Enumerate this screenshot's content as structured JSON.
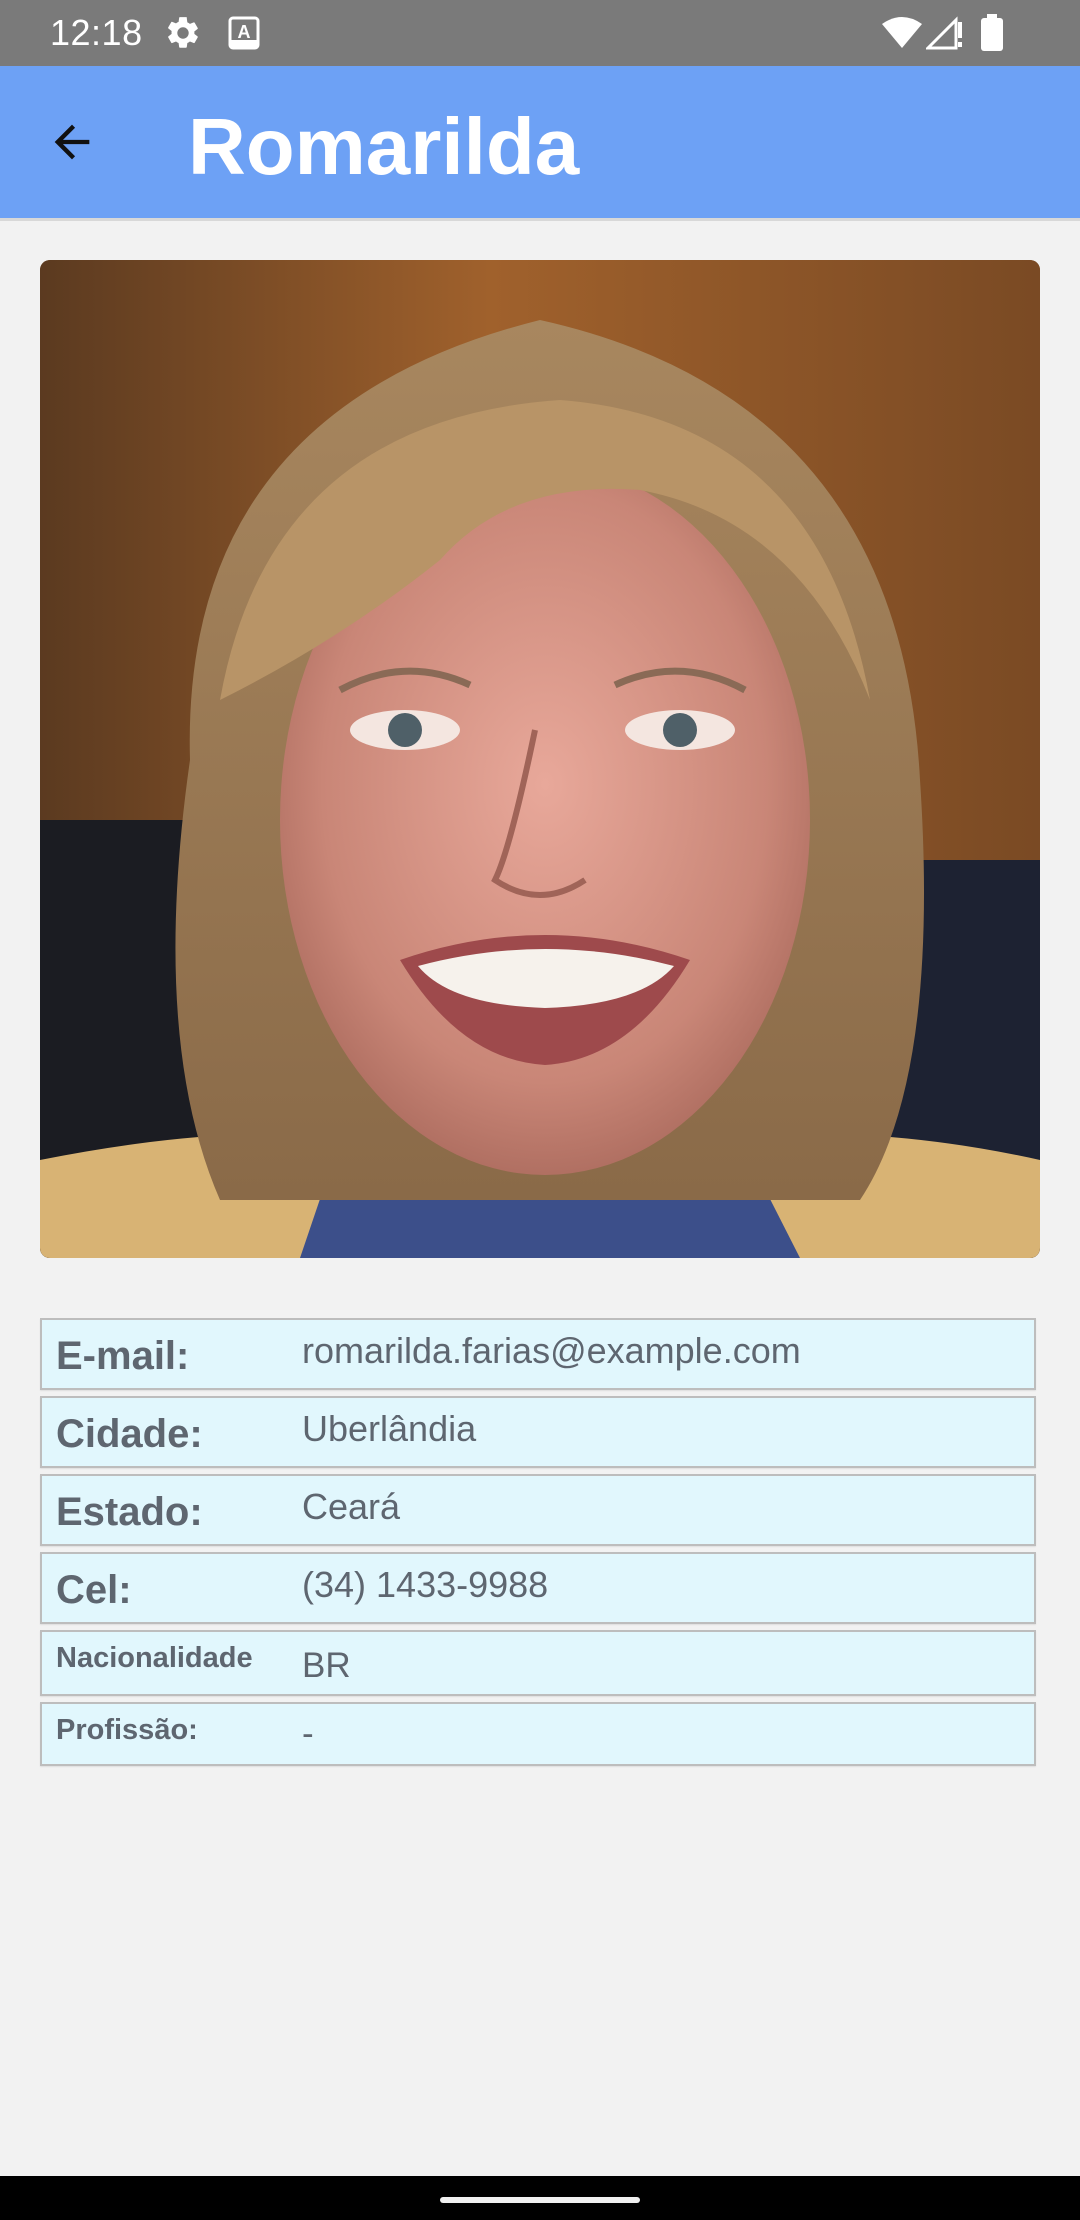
{
  "status_bar": {
    "time": "12:18",
    "icons": [
      "gear-icon",
      "font-a-icon",
      "wifi-icon",
      "signal-icon",
      "battery-icon"
    ]
  },
  "app_bar": {
    "title": "Romarilda",
    "back_icon": "arrow-back-icon",
    "color": "#6da1f5"
  },
  "profile_photo": {
    "subject": "smiling woman with shoulder-length blond hair"
  },
  "details": [
    {
      "label": "E-mail:",
      "value": "romarilda.farias@example.com"
    },
    {
      "label": "Cidade:",
      "value": "Uberlândia"
    },
    {
      "label": "Estado:",
      "value": "Ceará"
    },
    {
      "label": "Cel:",
      "value": "(34) 1433-9988"
    },
    {
      "label": "Nacionalidade",
      "value": "BR"
    },
    {
      "label": "Profissão:",
      "value": "-"
    }
  ],
  "colors": {
    "row_background": "#e1f7fd",
    "row_border": "#bdbdbd",
    "text": "#5e6670",
    "page_background": "#f2f2f2"
  }
}
